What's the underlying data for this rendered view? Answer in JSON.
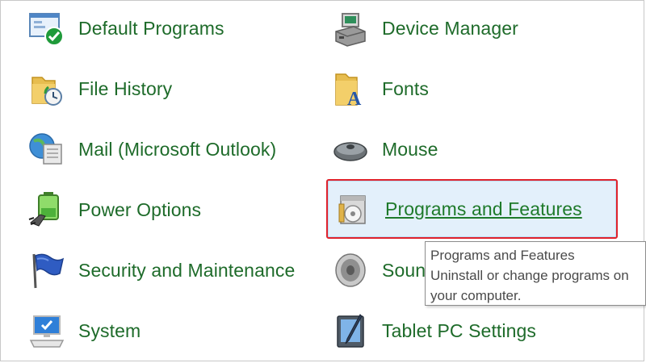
{
  "colors": {
    "link_text": "#1e6b2a",
    "hover_bg": "#e3f0fb",
    "highlight_border": "#e0222c"
  },
  "items": [
    {
      "label": "Default Programs",
      "icon": "default-programs-icon"
    },
    {
      "label": "Device Manager",
      "icon": "device-manager-icon"
    },
    {
      "label": "File History",
      "icon": "file-history-icon"
    },
    {
      "label": "Fonts",
      "icon": "fonts-icon"
    },
    {
      "label": "Mail (Microsoft Outlook)",
      "icon": "mail-icon"
    },
    {
      "label": "Mouse",
      "icon": "mouse-icon"
    },
    {
      "label": "Power Options",
      "icon": "power-options-icon"
    },
    {
      "label": "Programs and Features",
      "icon": "programs-and-features-icon"
    },
    {
      "label": "Security and Maintenance",
      "icon": "security-maintenance-icon"
    },
    {
      "label": "Sound",
      "icon": "sound-icon"
    },
    {
      "label": "System",
      "icon": "system-icon"
    },
    {
      "label": "Tablet PC Settings",
      "icon": "tablet-pc-settings-icon"
    }
  ],
  "tooltip": {
    "title": "Programs and Features",
    "description": "Uninstall or change programs on your computer."
  }
}
